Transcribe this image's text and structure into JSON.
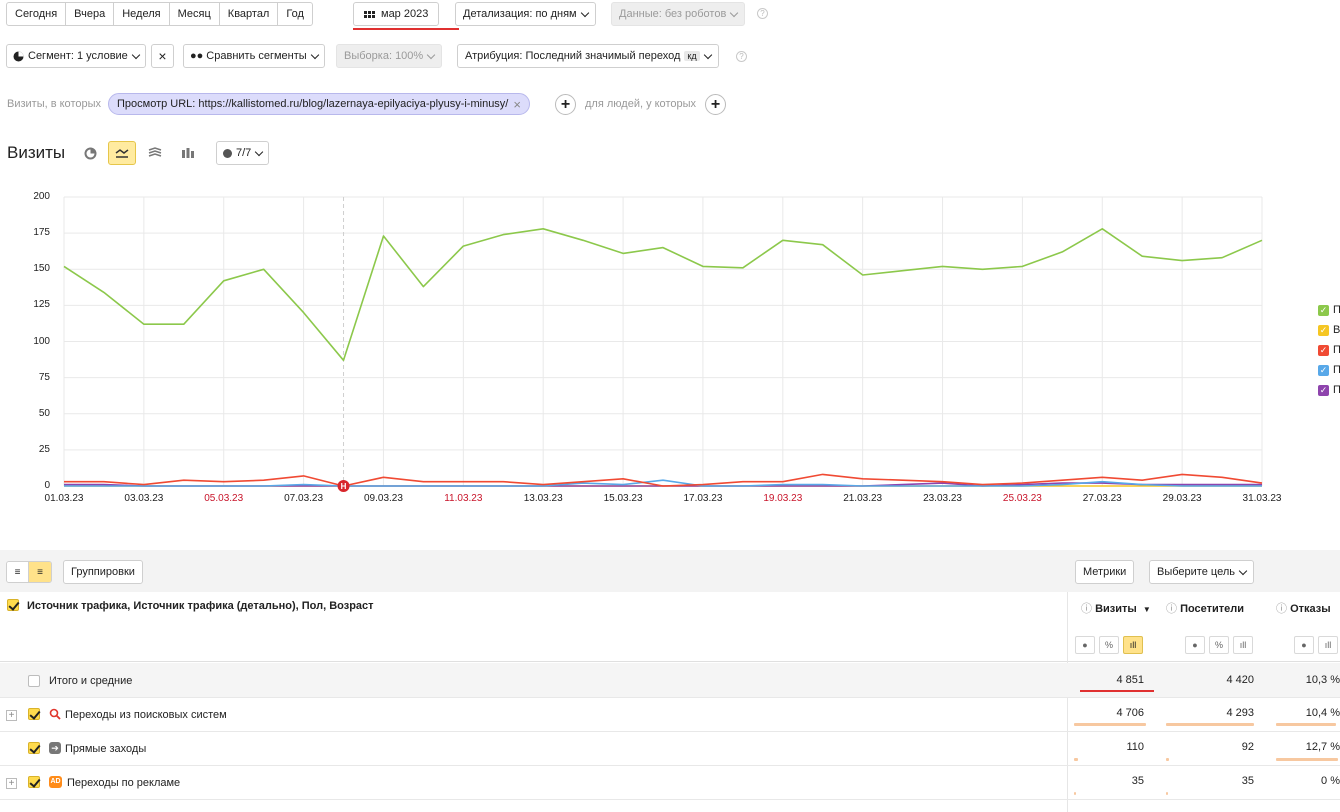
{
  "period_buttons": [
    "Сегодня",
    "Вчера",
    "Неделя",
    "Месяц",
    "Квартал",
    "Год"
  ],
  "date_range": "мар 2023",
  "detail": "Детализация: по дням",
  "robots": "Данные: без роботов",
  "segment": "Сегмент: 1 условие",
  "compare": "Сравнить сегменты",
  "sample": "Выборка: 100%",
  "attribution": "Атрибуция: Последний значимый переход",
  "attribution_badge": "кд",
  "filter": {
    "prefix": "Визиты, в которых",
    "chip": "Просмотр URL: https://kallistomed.ru/blog/lazernaya-epilyaciya-plyusy-i-minusy/",
    "suffix": "для людей, у которых"
  },
  "chart_title": "Визиты",
  "series_count": "7/7",
  "colors": {
    "green": "#8cc84b",
    "yellow": "#f5c623",
    "red": "#f04a33",
    "blue": "#58a8e8",
    "purple": "#8e44ad"
  },
  "legend": [
    {
      "label": "П",
      "color": "#8cc84b"
    },
    {
      "label": "В",
      "color": "#f5c623"
    },
    {
      "label": "П",
      "color": "#f04a33"
    },
    {
      "label": "П",
      "color": "#58a8e8"
    },
    {
      "label": "П",
      "color": "#8e44ad"
    }
  ],
  "annotation_marker": "Н",
  "chart_data": {
    "type": "line",
    "ylim": [
      0,
      200
    ],
    "yticks": [
      0,
      25,
      50,
      75,
      100,
      125,
      150,
      175,
      200
    ],
    "x": [
      "01.03.23",
      "02.03.23",
      "03.03.23",
      "04.03.23",
      "05.03.23",
      "06.03.23",
      "07.03.23",
      "08.03.23",
      "09.03.23",
      "10.03.23",
      "11.03.23",
      "12.03.23",
      "13.03.23",
      "14.03.23",
      "15.03.23",
      "16.03.23",
      "17.03.23",
      "18.03.23",
      "19.03.23",
      "20.03.23",
      "21.03.23",
      "22.03.23",
      "23.03.23",
      "24.03.23",
      "25.03.23",
      "26.03.23",
      "27.03.23",
      "28.03.23",
      "29.03.23",
      "30.03.23",
      "31.03.23"
    ],
    "xtick_labels": [
      {
        "label": "01.03.23",
        "weekend": false
      },
      {
        "label": "03.03.23",
        "weekend": false
      },
      {
        "label": "05.03.23",
        "weekend": true
      },
      {
        "label": "07.03.23",
        "weekend": false
      },
      {
        "label": "09.03.23",
        "weekend": false
      },
      {
        "label": "11.03.23",
        "weekend": true
      },
      {
        "label": "13.03.23",
        "weekend": false
      },
      {
        "label": "15.03.23",
        "weekend": false
      },
      {
        "label": "17.03.23",
        "weekend": false
      },
      {
        "label": "19.03.23",
        "weekend": true
      },
      {
        "label": "21.03.23",
        "weekend": false
      },
      {
        "label": "23.03.23",
        "weekend": false
      },
      {
        "label": "25.03.23",
        "weekend": true
      },
      {
        "label": "27.03.23",
        "weekend": false
      },
      {
        "label": "29.03.23",
        "weekend": false
      },
      {
        "label": "31.03.23",
        "weekend": false
      }
    ],
    "series": [
      {
        "color": "#8cc84b",
        "values": [
          152,
          134,
          112,
          112,
          142,
          150,
          120,
          87,
          173,
          138,
          166,
          174,
          178,
          170,
          161,
          165,
          152,
          151,
          170,
          167,
          146,
          149,
          152,
          150,
          152,
          162,
          178,
          159,
          156,
          158,
          170
        ]
      },
      {
        "color": "#f04a33",
        "values": [
          3,
          3,
          1,
          4,
          3,
          4,
          7,
          0,
          6,
          3,
          3,
          3,
          1,
          3,
          5,
          0,
          1,
          3,
          3,
          8,
          5,
          4,
          3,
          1,
          2,
          4,
          6,
          4,
          8,
          6,
          2
        ]
      },
      {
        "color": "#58a8e8",
        "values": [
          0,
          0,
          0,
          0,
          0,
          0,
          1,
          0,
          0,
          0,
          0,
          0,
          0,
          2,
          1,
          4,
          0,
          0,
          1,
          1,
          0,
          0,
          0,
          0,
          0,
          1,
          3,
          1,
          0,
          0,
          0
        ]
      },
      {
        "color": "#8e44ad",
        "values": [
          1,
          1,
          0,
          0,
          0,
          0,
          0,
          0,
          0,
          0,
          0,
          0,
          0,
          0,
          0,
          0,
          0,
          0,
          0,
          0,
          0,
          1,
          2,
          0,
          1,
          2,
          2,
          1,
          1,
          1,
          1
        ]
      },
      {
        "color": "#f5c623",
        "values": [
          0,
          0,
          0,
          0,
          0,
          0,
          0,
          0,
          0,
          0,
          0,
          0,
          0,
          0,
          0,
          0,
          0,
          0,
          0,
          0,
          0,
          0,
          0,
          0,
          0,
          0,
          0,
          0,
          0,
          0,
          0
        ]
      }
    ]
  },
  "table": {
    "groupings_btn": "Группировки",
    "metrics_btn": "Метрики",
    "goal_btn": "Выберите цель",
    "dimension_header": "Источник трафика, Источник трафика (детально), Пол, Возраст",
    "columns": [
      "Визиты",
      "Посетители",
      "Отказы"
    ],
    "sort_arrow": "▼",
    "mini_labels": {
      "pct": "%",
      "bars": "ıll"
    },
    "total": {
      "label": "Итого и средние",
      "values": [
        "4 851",
        "4 420",
        "10,3 %"
      ]
    },
    "rows": [
      {
        "label": "Переходы из поисковых систем",
        "values": [
          "4 706",
          "4 293",
          "10,4 %"
        ],
        "expandable": true,
        "icon": "search"
      },
      {
        "label": "Прямые заходы",
        "values": [
          "110",
          "92",
          "12,7 %"
        ],
        "expandable": false,
        "icon": "arrow"
      },
      {
        "label": "Переходы по рекламе",
        "values": [
          "35",
          "35",
          "0 %"
        ],
        "expandable": true,
        "icon": "ad"
      }
    ]
  }
}
